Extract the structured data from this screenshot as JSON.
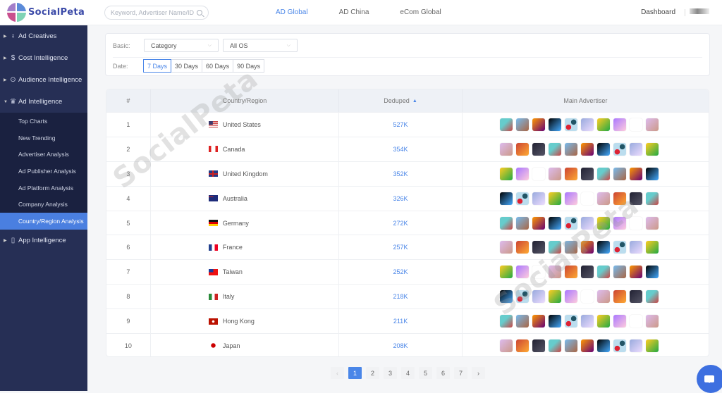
{
  "header": {
    "logo_text": "SocialPeta",
    "search_placeholder": "Keyword, Advertiser Name/ID",
    "tabs": [
      {
        "label": "AD Global",
        "active": true
      },
      {
        "label": "AD China",
        "active": false
      },
      {
        "label": "eCom Global",
        "active": false
      }
    ],
    "dashboard_label": "Dashboard"
  },
  "sidebar": {
    "items": [
      {
        "label": "Ad Creatives",
        "icon": "bulb-icon"
      },
      {
        "label": "Cost Intelligence",
        "icon": "dollar-icon"
      },
      {
        "label": "Audience Intelligence",
        "icon": "target-icon"
      },
      {
        "label": "Ad Intelligence",
        "icon": "trophy-icon",
        "expanded": true
      },
      {
        "label": "App Intelligence",
        "icon": "phone-icon"
      }
    ],
    "subitems": [
      {
        "label": "Top Charts"
      },
      {
        "label": "New Trending"
      },
      {
        "label": "Advertiser Analysis"
      },
      {
        "label": "Ad Publisher Analysis"
      },
      {
        "label": "Ad Platform Analysis"
      },
      {
        "label": "Company Analysis"
      },
      {
        "label": "Country/Region Analysis",
        "active": true
      }
    ]
  },
  "filters": {
    "basic_label": "Basic:",
    "category": "Category",
    "os": "All OS",
    "date_label": "Date:",
    "dates": [
      "7 Days",
      "30 Days",
      "60 Days",
      "90 Days"
    ],
    "active_date": "7 Days"
  },
  "table": {
    "headers": {
      "rank": "#",
      "country": "Country/Region",
      "deduped": "Deduped",
      "advertiser": "Main Advertiser"
    },
    "rows": [
      {
        "rank": "1",
        "country": "United States",
        "flag": "us",
        "deduped": "527K"
      },
      {
        "rank": "2",
        "country": "Canada",
        "flag": "ca",
        "deduped": "354K"
      },
      {
        "rank": "3",
        "country": "United Kingdom",
        "flag": "gb",
        "deduped": "352K"
      },
      {
        "rank": "4",
        "country": "Australia",
        "flag": "au",
        "deduped": "326K"
      },
      {
        "rank": "5",
        "country": "Germany",
        "flag": "de",
        "deduped": "272K"
      },
      {
        "rank": "6",
        "country": "France",
        "flag": "fr",
        "deduped": "257K"
      },
      {
        "rank": "7",
        "country": "Taiwan",
        "flag": "tw",
        "deduped": "252K"
      },
      {
        "rank": "8",
        "country": "Italy",
        "flag": "it",
        "deduped": "218K"
      },
      {
        "rank": "9",
        "country": "Hong Kong",
        "flag": "hk",
        "deduped": "211K"
      },
      {
        "rank": "10",
        "country": "Japan",
        "flag": "jp",
        "deduped": "208K"
      }
    ]
  },
  "pagination": {
    "prev": "‹",
    "pages": [
      "1",
      "2",
      "3",
      "4",
      "5",
      "6",
      "7"
    ],
    "current": "1",
    "next": "›"
  },
  "watermark": "SocialPeta"
}
